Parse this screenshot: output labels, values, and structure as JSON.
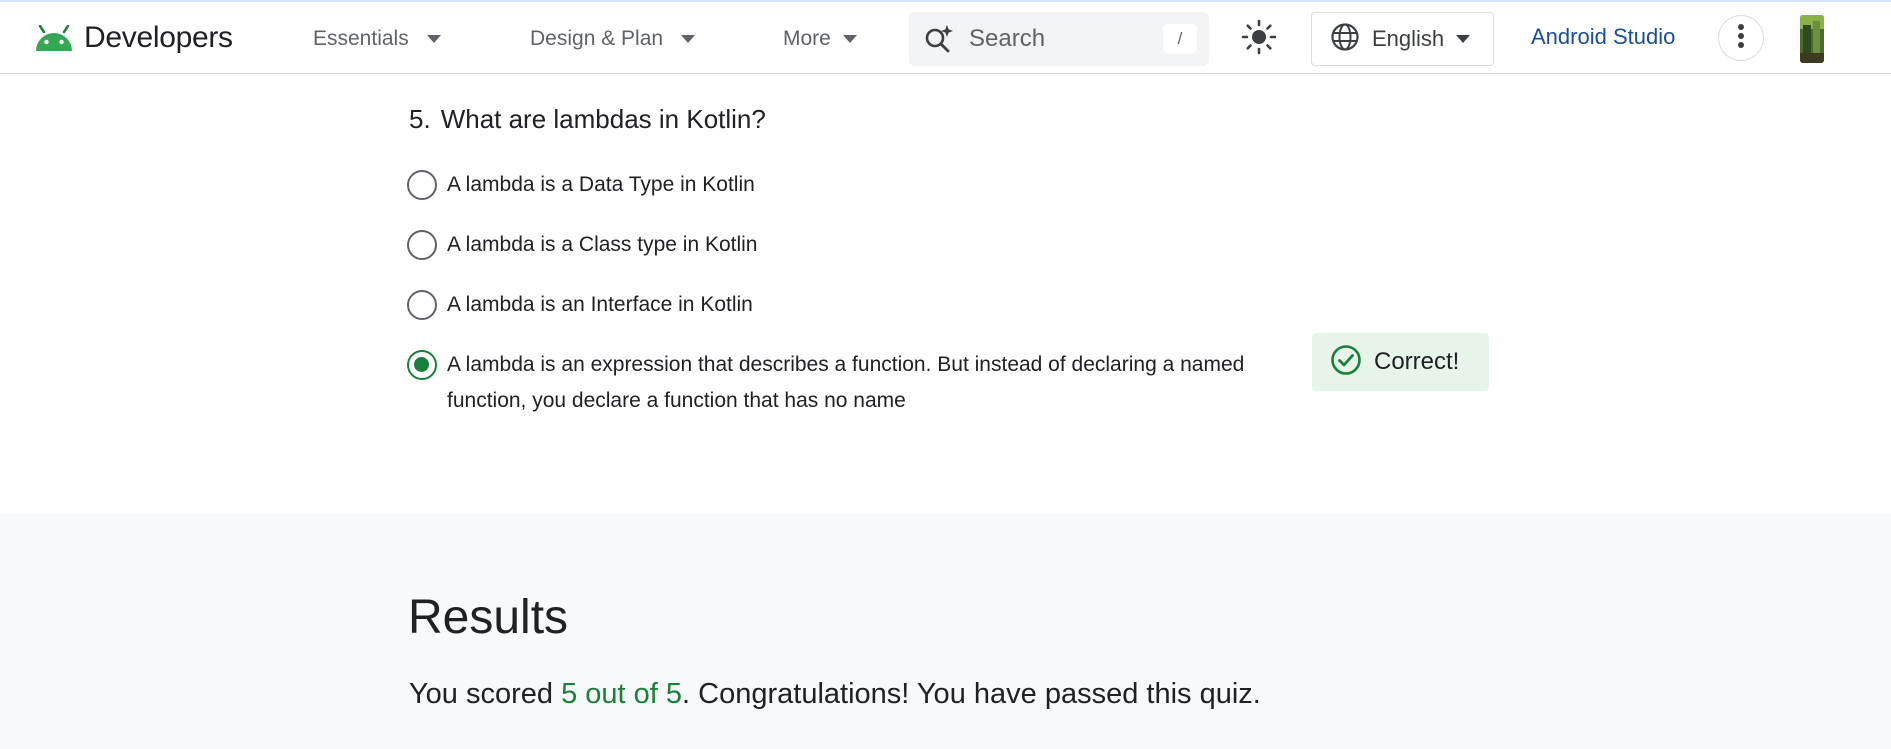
{
  "header": {
    "logo_text": "Developers",
    "nav": [
      {
        "label": "Essentials"
      },
      {
        "label": "Design & Plan"
      },
      {
        "label": "More"
      }
    ],
    "search": {
      "placeholder": "Search",
      "shortcut": "/"
    },
    "language": "English",
    "studio_link": "Android Studio"
  },
  "quiz": {
    "question_number": "5.",
    "question_text": "What are lambdas in Kotlin?",
    "options": [
      {
        "label": "A lambda is a Data Type in Kotlin",
        "selected": false
      },
      {
        "label": "A lambda is a Class type in Kotlin",
        "selected": false
      },
      {
        "label": "A lambda is an Interface in Kotlin",
        "selected": false
      },
      {
        "label": "A lambda is an expression that describes a function. But instead of declaring a named function, you declare a function that has no name",
        "selected": true
      }
    ],
    "feedback": "Correct!"
  },
  "results": {
    "title": "Results",
    "prefix": "You scored ",
    "score": "5 out of 5",
    "suffix": ". Congratulations! You have passed this quiz."
  },
  "colors": {
    "accent_green": "#188038",
    "link_blue": "#1a4fa0",
    "android_green": "#3ddc84",
    "badge_bg": "#e6f4ea"
  },
  "icons": [
    "android-logo-icon",
    "chevron-down-icon",
    "sparkle-search-icon",
    "sun-icon",
    "globe-icon",
    "more-vert-icon",
    "check-circle-icon"
  ]
}
